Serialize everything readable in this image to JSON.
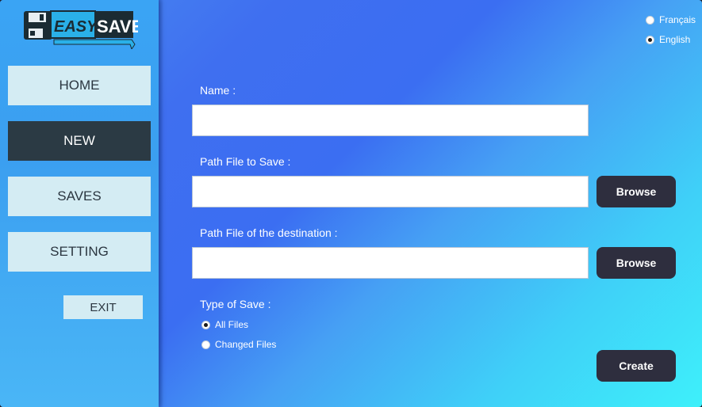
{
  "logo": {
    "word1": "EASY",
    "word2": "SAVE"
  },
  "sidebar": {
    "items": [
      {
        "label": "HOME"
      },
      {
        "label": "NEW"
      },
      {
        "label": "SAVES"
      },
      {
        "label": "SETTING"
      }
    ],
    "exit_label": "EXIT"
  },
  "language": {
    "options": [
      {
        "label": "Français",
        "checked": false
      },
      {
        "label": "English",
        "checked": true
      }
    ]
  },
  "form": {
    "name_label": "Name :",
    "name_value": "",
    "source_label": "Path File to Save :",
    "source_value": "",
    "dest_label": "Path File of the destination :",
    "dest_value": "",
    "browse_label": "Browse",
    "type_label": "Type of Save :",
    "type_options": [
      {
        "label": "All Files",
        "checked": true
      },
      {
        "label": "Changed Files",
        "checked": false
      }
    ],
    "create_label": "Create"
  }
}
